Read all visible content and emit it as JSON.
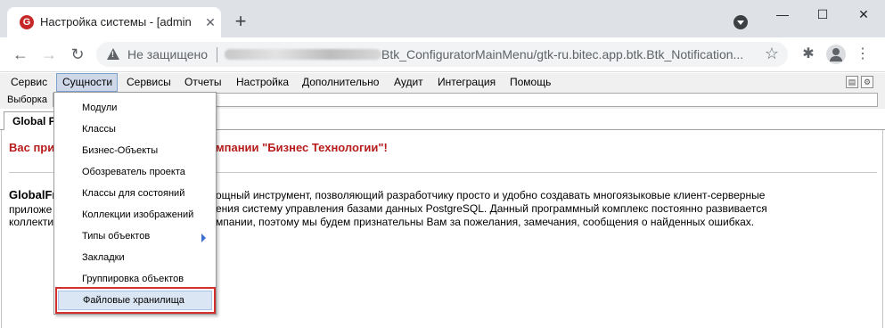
{
  "browser": {
    "tab_title": "Настройка системы - [admin@",
    "tab_favicon": "G",
    "tab_close": "✕",
    "new_tab": "+",
    "window_controls": [
      "—",
      "☐",
      "✕"
    ],
    "nav": {
      "back": "←",
      "forward": "→",
      "reload": "↻"
    },
    "security_text": "Не защищено",
    "url": "Btk_ConfiguratorMainMenu/gtk-ru.bitec.app.btk.Btk_Notification...",
    "star": "☆",
    "extensions": "✱",
    "menu": "⋮",
    "icons": [
      "favicon-g-icon",
      "tab-search-icon",
      "warning-icon",
      "star-icon",
      "extensions-icon",
      "profile-icon",
      "kebab-menu-icon"
    ]
  },
  "menubar": {
    "items": [
      "Сервис",
      "Сущности",
      "Сервисы",
      "Отчеты",
      "Настройка",
      "Дополнительно",
      "Аудит",
      "Интеграция",
      "Помощь"
    ],
    "active_index": 1
  },
  "filter": {
    "label": "Выборка",
    "value": ""
  },
  "app_tab": {
    "label": "Global Pr"
  },
  "content": {
    "welcome_start": "Вас при",
    "welcome_end": "мпании \"Бизнес Технологии\"!",
    "brand": "GlobalFr",
    "line1_start": "приложе",
    "line2_start": "коллекти",
    "line0_rest": "ощный инструмент, позволяющий разработчику просто и удобно создавать многоязыковые клиент-серверные",
    "line1_rest": "ения систему управления базами данных PostgreSQL. Данный программный комплекс постоянно развивается",
    "line2_rest": "мпании, поэтому мы будем признательны Вам за пожелания, замечания, сообщения о найденных ошибках."
  },
  "dropdown": {
    "items": [
      "Модули",
      "Классы",
      "Бизнес-Объекты",
      "Обозреватель проекта",
      "Классы для состояний",
      "Коллекции изображений",
      "Типы объектов",
      "Закладки",
      "Группировка объектов",
      "Файловые хранилища"
    ],
    "highlighted_index": 9,
    "submenu_index": 6
  },
  "colors": {
    "accent_red": "#b71c1c",
    "highlight_border": "#d32f2f",
    "menu_active": "#cfd8e8"
  }
}
